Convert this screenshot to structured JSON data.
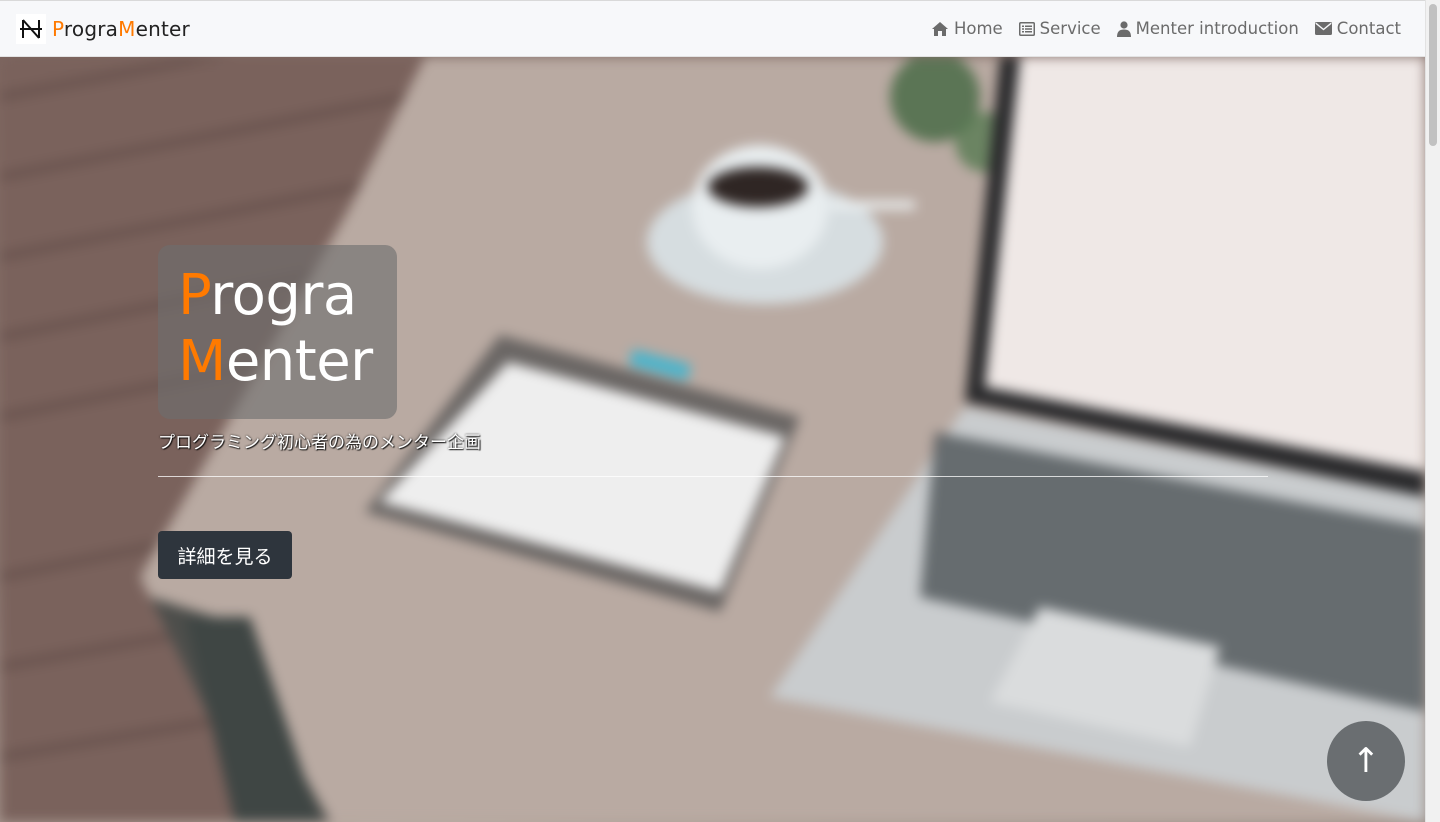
{
  "brand": {
    "logo_icon": "n-strike-logo-icon",
    "name_p": "P",
    "name_rogra": "rogra",
    "name_m": "M",
    "name_enter": "enter"
  },
  "nav": {
    "items": [
      {
        "label": "Home",
        "icon": "home-icon"
      },
      {
        "label": "Service",
        "icon": "list-icon"
      },
      {
        "label": "Menter introduction",
        "icon": "user-icon"
      },
      {
        "label": "Contact",
        "icon": "envelope-icon"
      }
    ]
  },
  "hero": {
    "title_line1_first": "P",
    "title_line1_rest": "rogra",
    "title_line2_first": "M",
    "title_line2_rest": "enter",
    "subtitle": "プログラミング初心者の為のメンター企画",
    "details_button": "詳細を見る",
    "scroll_top_label": "↑"
  },
  "colors": {
    "accent": "#ff7a00",
    "navbar_bg": "#f7f8fa",
    "button_dark": "#2e353d",
    "nav_text": "#6b6b6b"
  }
}
